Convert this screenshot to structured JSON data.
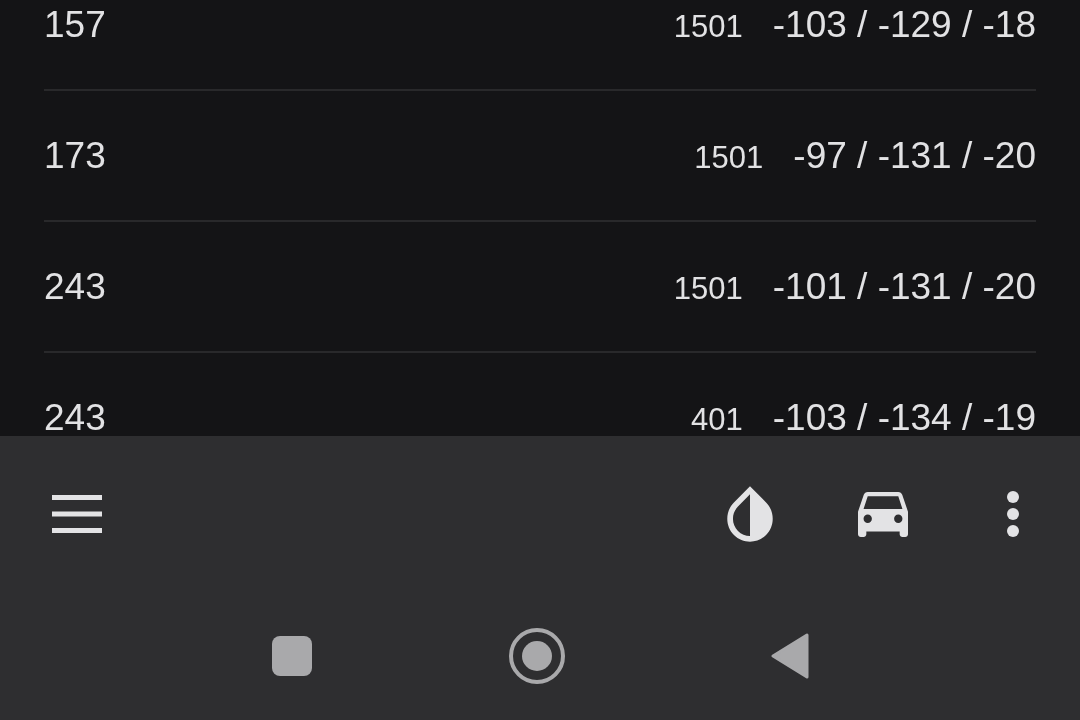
{
  "rows": [
    {
      "column_1": "157",
      "column_2": "1501",
      "column_3": "-103 / -129 / -18"
    },
    {
      "column_1": "173",
      "column_2": "1501",
      "column_3": "-97 / -131 / -20"
    },
    {
      "column_1": "243",
      "column_2": "1501",
      "column_3": "-101 / -131 / -20"
    },
    {
      "column_1": "243",
      "column_2": "401",
      "column_3": "-103 / -134 / -19"
    }
  ]
}
